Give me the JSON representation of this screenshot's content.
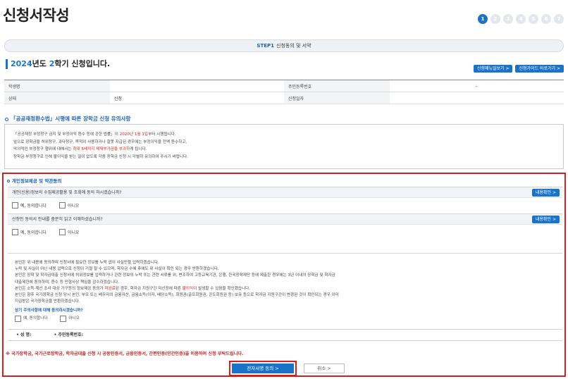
{
  "page": {
    "title": "신청서작성"
  },
  "steps": [
    "1",
    "2",
    "3",
    "4",
    "5",
    "6",
    "7"
  ],
  "step_bar": {
    "step_no": "STEP1",
    "label": "신청동의 및 서약"
  },
  "semester": {
    "year": "2024",
    "year_suffix": "년도 ",
    "term": "2",
    "term_suffix": "학기 신청입니다."
  },
  "top_buttons": {
    "menu": "신청메뉴얼보기 >",
    "guide": "신청가이드 바로가기 >"
  },
  "info_table": {
    "student_label": "학생명",
    "student_value": "",
    "rrn_label": "주민등록번호",
    "rrn_value": "-",
    "status_label": "상태",
    "status_value": "신청",
    "date_label": "신청일자",
    "date_value": ""
  },
  "notice": {
    "title": "「공공재정환수법」시행에 따른 장학금 신청 유의사항",
    "line1_a": "「공공재정 부정청구 금지 및 부정이익 환수 등에 관한 법률」이 ",
    "line1_red": "2020년 1월 1일",
    "line1_b": "부터 시행됩니다.",
    "line2": "앞으로 장학금을 허위청구, 과다청구, 목적외 사용하거나 잘못 지급된 경우에는 부정이익을 전액 환수하고,",
    "line3_a": "악의적인 부정청구 행위에 대해서는 ",
    "line3_red": "최대 5배까지 제재부가금을 부과",
    "line3_b": "하게 됩니다.",
    "line4": "장학금 부정청구로 인해 불이익을 받는 일이 없도록 각종 장학금 신청 시 각별히 유의하여 주시기 바랍니다."
  },
  "consent": {
    "title": "개인정보제공 및 약관동의",
    "q1": "개인(신용)정보의 수집제공활용 및 조회에 동의 하시겠습니까?",
    "q2": "신청인 동의서 안내를 충분히 읽고 이해하셨습니까?",
    "detail_button": "내용확인 >",
    "yes": "예, 동의합니다",
    "no": "아니오"
  },
  "pledge": {
    "l1": "본인은 위 내용에 동의하며 신청서에 필요한 정보를 누락 없이 사실만을 입력하겠습니다.",
    "l2": "누락 및 사실이 아닌 내용 입력으로 신청이 거절 될 수 있으며, 학자금 수혜 후에도 위 사실이 확인 되는 경우 반환하겠습니다.",
    "l3": "본인은 장학 및 학자금대출 신청서에 허위정보를 입력하거나 관련 정보의 누락 또는 관련 서류를 위, 변조하여 고등교육기관, 은행, 한국장학재단 등에 제출한 경우에는 3년 이내의 장학금 및 학자금",
    "l4": "대출제한에 동의하며, 환수 등 민형사상 책임을 감수하겠습니다.",
    "l5_a": "본인은 소득·재산 조사 대상 가구원의 정보제공 동의가 ",
    "l5_red1": "미완료",
    "l5_b": "된 경우, 학자금 지원구간 미산정에 따른 ",
    "l5_red2": "불이익",
    "l5_c": "이 발생할 수 있음을 확인했습니다.",
    "l6": "본인은 향후 국가장학금 신청 당시 본인, 부모 또는 배우자의 금융자산, 금융소득(이자, 배당소득), 회원권(골프회원권, 콘도회원권 등) 보유 등으로 학자금 지원구간이 변경된 것이 확인되는 경우 이미",
    "l7": "지급받은 국가장학금을 반환하겠습니다.",
    "question": "상기 주의사항에 대해 동의하시겠습니까?"
  },
  "sign": {
    "name_label": "• 성 명:",
    "rrn_label": "• 주민등록번호:"
  },
  "warning": "※ 국가장학금, 국가근로장학금, 학자금대출 신청 시 공동인증서, 금융인증서, 간편인증(민간인증)을 이용하여 신청 부탁드립니다.",
  "buttons": {
    "sign": "전자서명 동의  >",
    "cancel": "취소  >"
  },
  "colors": {
    "accent": "#1a73c9",
    "warning": "#d21f1f"
  }
}
